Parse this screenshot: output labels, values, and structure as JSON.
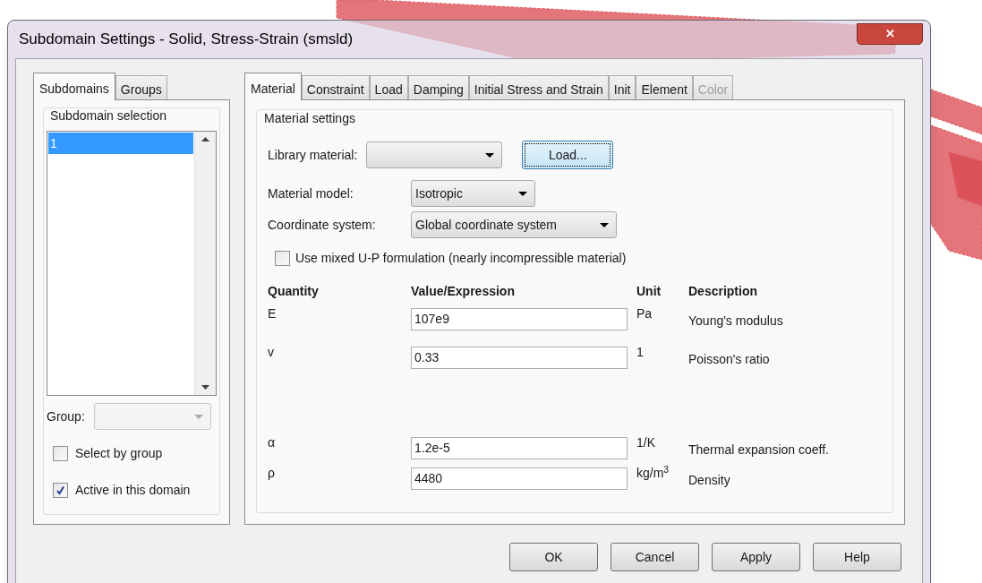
{
  "window": {
    "title": "Subdomain Settings - Solid, Stress-Strain (smsld)",
    "close": "✕"
  },
  "left_tabs": [
    {
      "label": "Subdomains",
      "selected": true
    },
    {
      "label": "Groups",
      "selected": false
    }
  ],
  "subdomain_selection": {
    "title": "Subdomain selection",
    "items": [
      {
        "label": "1",
        "selected": true
      }
    ],
    "group_label": "Group:",
    "checkboxes": [
      {
        "label": "Select by group",
        "checked": false
      },
      {
        "label": "Active in this domain",
        "checked": true
      }
    ]
  },
  "tabs": [
    {
      "label": "Material",
      "selected": true,
      "disabled": false
    },
    {
      "label": "Constraint",
      "selected": false,
      "disabled": false
    },
    {
      "label": "Load",
      "selected": false,
      "disabled": false
    },
    {
      "label": "Damping",
      "selected": false,
      "disabled": false
    },
    {
      "label": "Initial Stress and Strain",
      "selected": false,
      "disabled": false
    },
    {
      "label": "Init",
      "selected": false,
      "disabled": false
    },
    {
      "label": "Element",
      "selected": false,
      "disabled": false
    },
    {
      "label": "Color",
      "selected": false,
      "disabled": true
    }
  ],
  "material_settings": {
    "title": "Material settings",
    "library_label": "Library material:",
    "load_button": "Load...",
    "model_label": "Material model:",
    "model_value": "Isotropic",
    "coord_label": "Coordinate system:",
    "coord_value": "Global coordinate system",
    "mixed": {
      "label": "Use mixed U-P formulation (nearly incompressible material)",
      "checked": false
    },
    "columns": [
      "Quantity",
      "Value/Expression",
      "Unit",
      "Description"
    ],
    "rows": [
      {
        "quantity": "E",
        "value": "107e9",
        "unit": "Pa",
        "description": "Young's modulus"
      },
      {
        "quantity": "v",
        "value": "0.33",
        "unit": "1",
        "description": "Poisson's ratio"
      },
      {
        "quantity": "α",
        "value": "1.2e-5",
        "unit": "1/K",
        "description": "Thermal expansion coeff."
      },
      {
        "quantity": "ρ",
        "value": "4480",
        "unit": "kg/m$^{3}$",
        "description": "Density"
      }
    ]
  },
  "buttons": [
    "OK",
    "Cancel",
    "Apply",
    "Help"
  ]
}
